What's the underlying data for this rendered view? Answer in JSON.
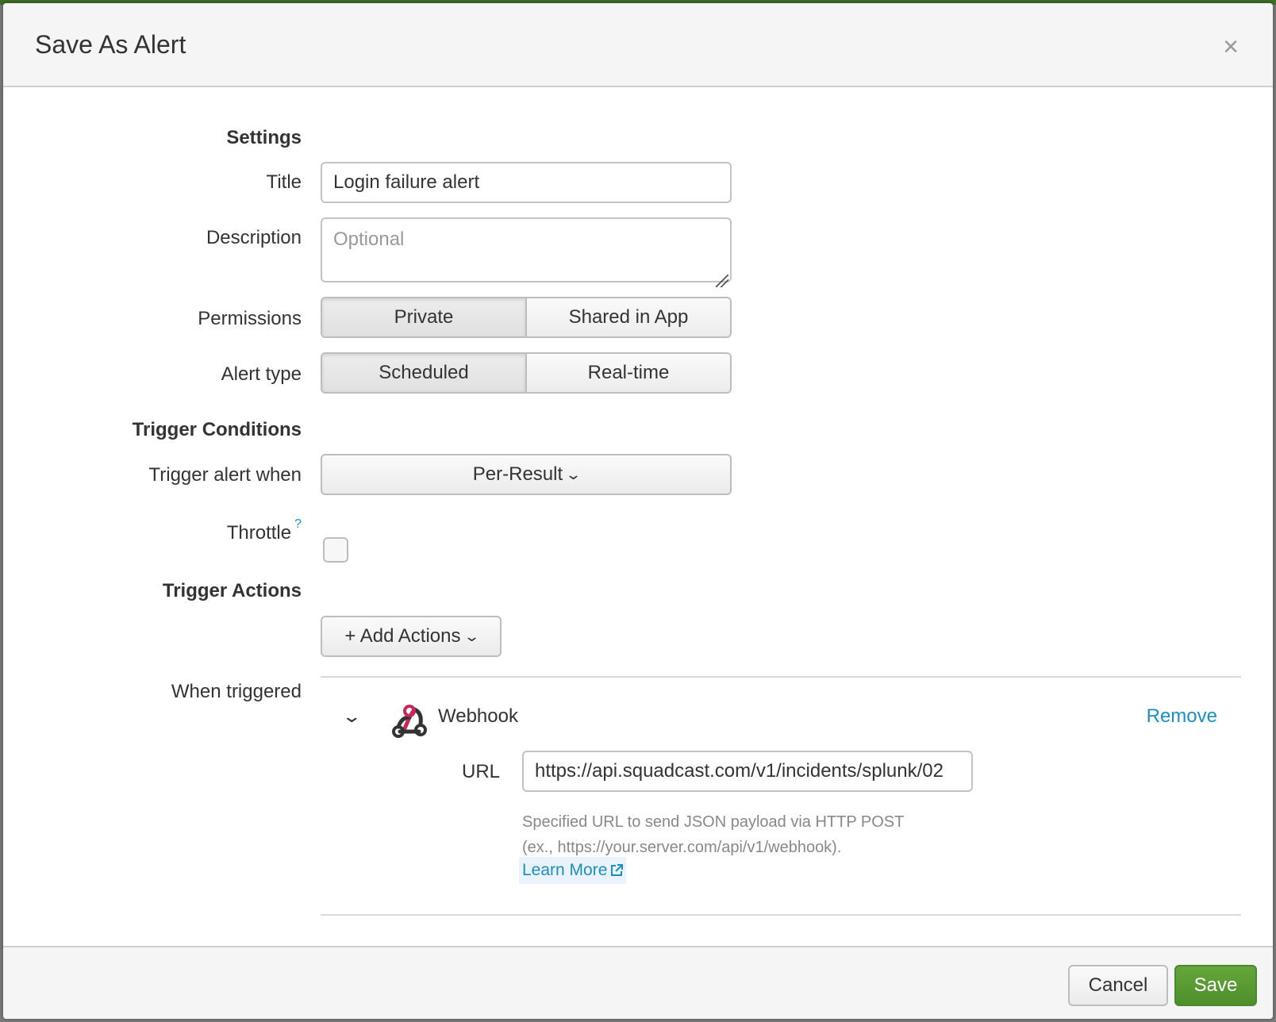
{
  "dialog": {
    "title": "Save As Alert",
    "close_symbol": "×"
  },
  "settings": {
    "heading": "Settings",
    "title_label": "Title",
    "title_value": "Login failure alert",
    "description_label": "Description",
    "description_placeholder": "Optional",
    "permissions_label": "Permissions",
    "permissions_options": [
      "Private",
      "Shared in App"
    ],
    "permissions_selected": "Private",
    "alert_type_label": "Alert type",
    "alert_type_options": [
      "Scheduled",
      "Real-time"
    ],
    "alert_type_selected": "Scheduled"
  },
  "trigger_conditions": {
    "heading": "Trigger Conditions",
    "trigger_when_label": "Trigger alert when",
    "trigger_when_value": "Per-Result",
    "throttle_label": "Throttle",
    "throttle_help": "?",
    "throttle_checked": false
  },
  "trigger_actions": {
    "heading": "Trigger Actions",
    "add_actions_label": "+ Add Actions",
    "when_triggered_label": "When triggered",
    "action": {
      "name": "Webhook",
      "icon": "webhook-icon",
      "remove_label": "Remove",
      "url_label": "URL",
      "url_value": "https://api.squadcast.com/v1/incidents/splunk/02",
      "help_line1": "Specified URL to send JSON payload via HTTP POST",
      "help_line2": "(ex., https://your.server.com/api/v1/webhook).",
      "learn_more_label": "Learn More"
    }
  },
  "footer": {
    "cancel_label": "Cancel",
    "save_label": "Save"
  },
  "colors": {
    "accent_link": "#1a8fc6",
    "save_button": "#5a9b34",
    "webhook_pink": "#c7275a"
  }
}
